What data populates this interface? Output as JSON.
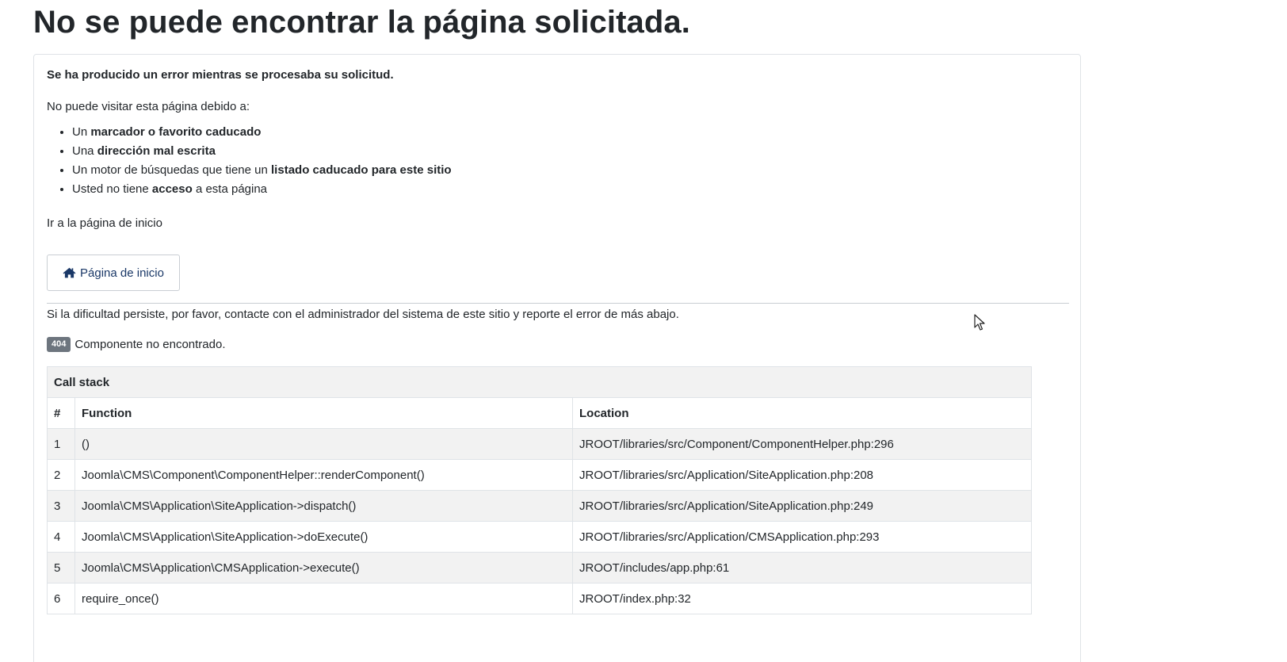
{
  "page": {
    "title": "No se puede encontrar la página solicitada."
  },
  "card": {
    "lead": "Se ha producido un error mientras se procesaba su solicitud.",
    "reason_intro": "No puede visitar esta página debido a:",
    "reasons": [
      {
        "pre": "Un ",
        "bold": "marcador o favorito caducado",
        "post": ""
      },
      {
        "pre": "Una ",
        "bold": "dirección mal escrita",
        "post": ""
      },
      {
        "pre": "Un motor de búsquedas que tiene un ",
        "bold": "listado caducado para este sitio",
        "post": ""
      },
      {
        "pre": "Usted no tiene ",
        "bold": "acceso",
        "post": " a esta página"
      }
    ],
    "home_intro": "Ir a la página de inicio",
    "home_button_label": "Página de inicio",
    "home_button_icon": "home-icon",
    "persist_text": "Si la dificultad persiste, por favor, contacte con el administrador del sistema de este sitio y reporte el error de más abajo.",
    "error_code": "404",
    "error_message": "Componente no encontrado."
  },
  "callstack": {
    "caption": "Call stack",
    "headers": {
      "num": "#",
      "function": "Function",
      "location": "Location"
    },
    "rows": [
      {
        "num": "1",
        "function": "()",
        "location": "JROOT/libraries/src/Component/ComponentHelper.php:296"
      },
      {
        "num": "2",
        "function": "Joomla\\CMS\\Component\\ComponentHelper::renderComponent()",
        "location": "JROOT/libraries/src/Application/SiteApplication.php:208"
      },
      {
        "num": "3",
        "function": "Joomla\\CMS\\Application\\SiteApplication->dispatch()",
        "location": "JROOT/libraries/src/Application/SiteApplication.php:249"
      },
      {
        "num": "4",
        "function": "Joomla\\CMS\\Application\\SiteApplication->doExecute()",
        "location": "JROOT/libraries/src/Application/CMSApplication.php:293"
      },
      {
        "num": "5",
        "function": "Joomla\\CMS\\Application\\CMSApplication->execute()",
        "location": "JROOT/includes/app.php:61"
      },
      {
        "num": "6",
        "function": "require_once()",
        "location": "JROOT/index.php:32"
      }
    ]
  },
  "colors": {
    "text": "#22262a",
    "button_text": "#1a3867",
    "badge_bg": "#6d757e",
    "stripe_bg": "#f2f2f2",
    "border": "#dfe3e7"
  }
}
